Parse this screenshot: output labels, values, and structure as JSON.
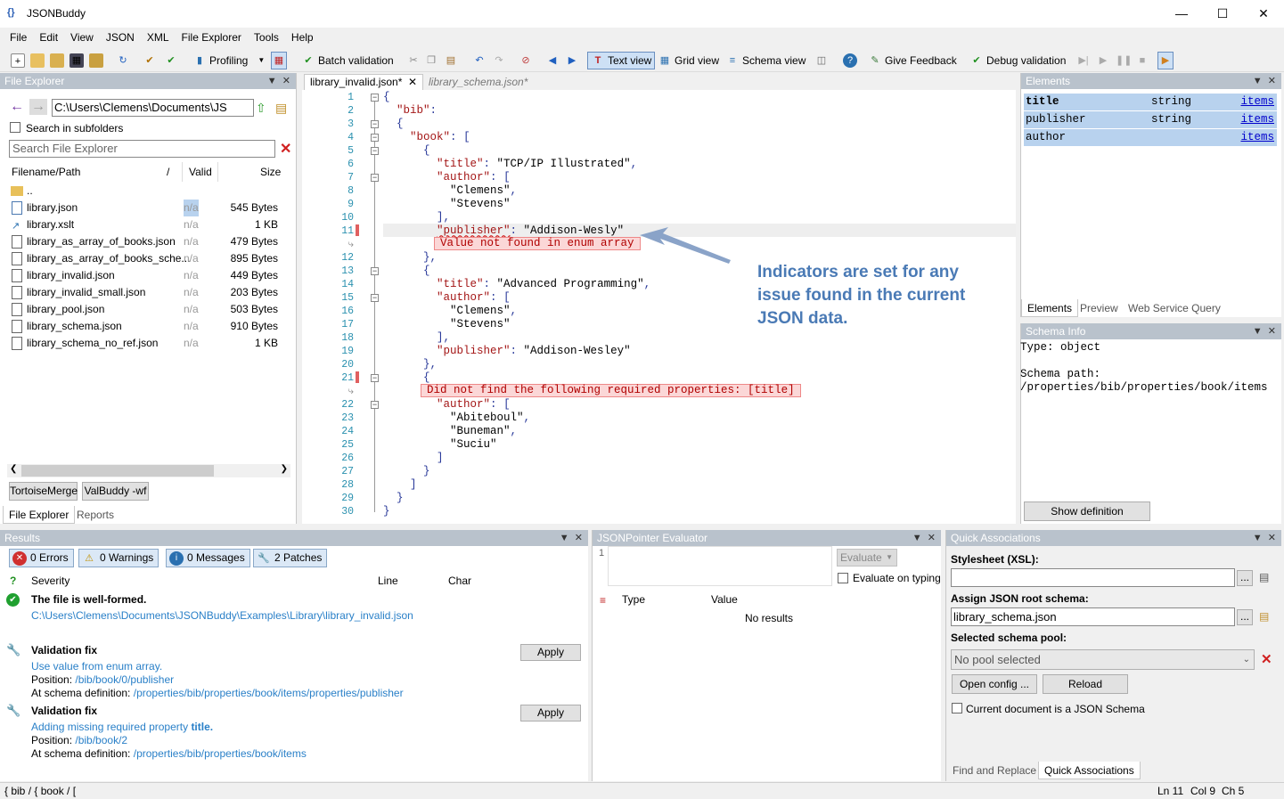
{
  "window": {
    "title": "JSONBuddy",
    "app_icon": "{}"
  },
  "menu": [
    "File",
    "Edit",
    "View",
    "JSON",
    "XML",
    "File Explorer",
    "Tools",
    "Help"
  ],
  "toolbar": {
    "profiling": "Profiling",
    "batch": "Batch validation",
    "text_view": "Text view",
    "grid_view": "Grid view",
    "schema_view": "Schema view",
    "feedback": "Give Feedback",
    "debug": "Debug validation"
  },
  "file_explorer": {
    "title": "File Explorer",
    "path": "C:\\Users\\Clemens\\Documents\\JS",
    "search_sub": "Search in subfolders",
    "search_placeholder": "Search File Explorer",
    "col_name": "Filename/Path",
    "col_slash": "/",
    "col_valid": "Valid",
    "col_size": "Size",
    "parent": "..",
    "files": [
      {
        "name": "library.json",
        "valid": "n/a",
        "size": "545 Bytes"
      },
      {
        "name": "library.xslt",
        "valid": "n/a",
        "size": "1 KB"
      },
      {
        "name": "library_as_array_of_books.json",
        "valid": "n/a",
        "size": "479 Bytes"
      },
      {
        "name": "library_as_array_of_books_sche...",
        "valid": "n/a",
        "size": "895 Bytes"
      },
      {
        "name": "library_invalid.json",
        "valid": "n/a",
        "size": "449 Bytes"
      },
      {
        "name": "library_invalid_small.json",
        "valid": "n/a",
        "size": "203 Bytes"
      },
      {
        "name": "library_pool.json",
        "valid": "n/a",
        "size": "503 Bytes"
      },
      {
        "name": "library_schema.json",
        "valid": "n/a",
        "size": "910 Bytes"
      },
      {
        "name": "library_schema_no_ref.json",
        "valid": "n/a",
        "size": "1 KB"
      }
    ],
    "btn_tortoise": "TortoiseMerge",
    "btn_valbuddy": "ValBuddy -wf",
    "tab_fe": "File Explorer",
    "tab_reports": "Reports"
  },
  "editor": {
    "tab_active": "library_invalid.json*",
    "tab_other": "library_schema.json*",
    "lines": [
      "{",
      "  \"bib\":",
      "  {",
      "    \"book\": [",
      "      {",
      "        \"title\": \"TCP/IP Illustrated\",",
      "        \"author\": [",
      "          \"Clemens\",",
      "          \"Stevens\"",
      "        ],",
      "        \"publisher\": \"Addison-Wesly\"",
      "      },",
      "      {",
      "        \"title\": \"Advanced Programming\",",
      "        \"author\": [",
      "          \"Clemens\",",
      "          \"Stevens\"",
      "        ],",
      "        \"publisher\": \"Addison-Wesley\"",
      "      },",
      "      {",
      "        \"author\": [",
      "          \"Abiteboul\",",
      "          \"Buneman\",",
      "          \"Suciu\"",
      "        ]",
      "      }",
      "    ]",
      "  }",
      "}"
    ],
    "err1": "Value not found in enum array",
    "err2": "Did not find the following required properties: [title]",
    "callout": "Indicators are set for any issue found in the current JSON data."
  },
  "elements": {
    "title": "Elements",
    "rows": [
      {
        "name": "title",
        "type": "string",
        "link": "items"
      },
      {
        "name": "publisher",
        "type": "string",
        "link": "items"
      },
      {
        "name": "author",
        "type": "",
        "link": "items"
      }
    ],
    "tabs": [
      "Elements",
      "Preview",
      "Web Service Query"
    ]
  },
  "schema_info": {
    "title": "Schema Info",
    "type": "Type: object",
    "path_label": "Schema path:",
    "path": "/properties/bib/properties/book/items",
    "btn": "Show definition"
  },
  "results": {
    "title": "Results",
    "errors": "0 Errors",
    "warnings": "0 Warnings",
    "messages": "0 Messages",
    "patches": "2 Patches",
    "col_q": "?",
    "col_sev": "Severity",
    "col_line": "Line",
    "col_char": "Char",
    "wellformed": "The file is well-formed.",
    "file": "C:\\Users\\Clemens\\Documents\\JSONBuddy\\Examples\\Library\\library_invalid.json",
    "fix1_title": "Validation fix",
    "fix1_desc": "Use value from enum array.",
    "fix1_pos_label": "Position:",
    "fix1_pos": "/bib/book/0/publisher",
    "fix1_def_label": "At schema definition:",
    "fix1_def": "/properties/bib/properties/book/items/properties/publisher",
    "fix2_title": "Validation fix",
    "fix2_desc": "Adding missing required property ",
    "fix2_desc_bold": "title.",
    "fix2_pos_label": "Position:",
    "fix2_pos": "/bib/book/2",
    "fix2_def_label": "At schema definition:",
    "fix2_def": "/properties/bib/properties/book/items",
    "apply": "Apply"
  },
  "jsonpointer": {
    "title": "JSONPointer Evaluator",
    "line": "1",
    "evaluate": "Evaluate",
    "eval_typing": "Evaluate on typing",
    "col_type": "Type",
    "col_value": "Value",
    "no_results": "No results"
  },
  "quick": {
    "title": "Quick Associations",
    "xsl_label": "Stylesheet (XSL):",
    "root_label": "Assign JSON root schema:",
    "root_value": "library_schema.json",
    "pool_label": "Selected schema pool:",
    "pool_value": "No pool selected",
    "open_config": "Open config ...",
    "reload": "Reload",
    "cur_schema": "Current document is a JSON Schema",
    "tab_find": "Find and Replace",
    "tab_quick": "Quick Associations"
  },
  "status": {
    "path": "{ bib / { book / [",
    "ln": "Ln 11",
    "col": "Col 9",
    "ch": "Ch 5"
  }
}
